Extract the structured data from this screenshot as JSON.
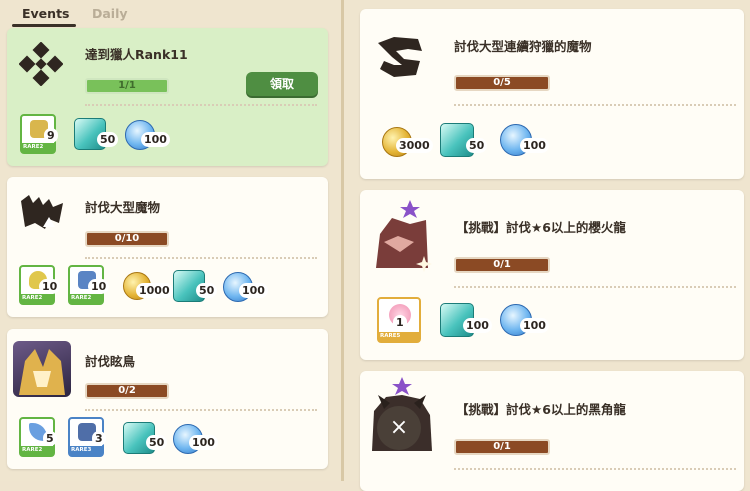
{
  "tabs": [
    {
      "label": "Events"
    },
    {
      "label": "Daily"
    }
  ],
  "left_cards": [
    {
      "title": "達到獵人Rank11",
      "progress": "1/1",
      "claim_label": "領取",
      "rewards": [
        {
          "count": "9",
          "rare": "RARE2"
        },
        {
          "count": "50"
        },
        {
          "count": "100"
        }
      ]
    },
    {
      "title": "討伐大型魔物",
      "progress": "0/10",
      "rewards": [
        {
          "count": "10",
          "rare": "RARE2"
        },
        {
          "count": "10",
          "rare": "RARE2"
        },
        {
          "count": "1000"
        },
        {
          "count": "50"
        },
        {
          "count": "100"
        }
      ]
    },
    {
      "title": "討伐眩鳥",
      "progress": "0/2",
      "rewards": [
        {
          "count": "5",
          "rare": "RARE2"
        },
        {
          "count": "3",
          "rare": "RARE3"
        },
        {
          "count": "50"
        },
        {
          "count": "100"
        }
      ]
    }
  ],
  "right_cards": [
    {
      "title": "討伐大型連續狩獵的魔物",
      "progress": "0/5",
      "rewards": [
        {
          "count": "3000"
        },
        {
          "count": "50"
        },
        {
          "count": "100"
        }
      ]
    },
    {
      "title": "【挑戰】討伐★6以上的櫻火龍",
      "progress": "0/1",
      "rewards": [
        {
          "count": "1",
          "rare": "RARE5"
        },
        {
          "count": "100"
        },
        {
          "count": "100"
        }
      ]
    },
    {
      "title": "【挑戰】討伐★6以上的黑角龍",
      "progress": "0/1"
    }
  ],
  "close_button": {
    "label": "×"
  },
  "colors": {
    "accent_green": "#4f8e42",
    "progress_brown": "#8b4a24",
    "card_complete": "#d9efc6"
  }
}
